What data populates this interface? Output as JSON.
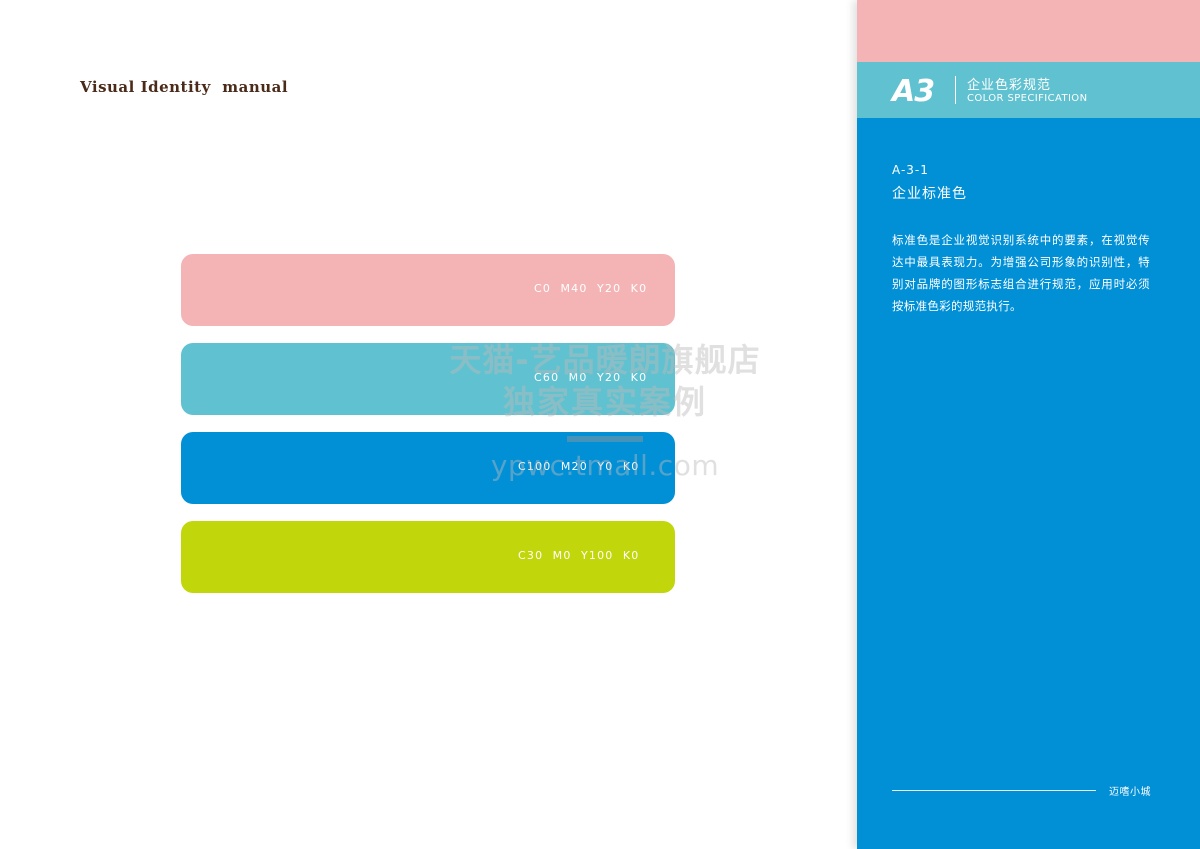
{
  "document": {
    "manual_title": "Visual Identity  manual"
  },
  "swatches": [
    {
      "label": "C0  M40  Y20  K0",
      "color": "#f4b4b5"
    },
    {
      "label": "C60  M0  Y20  K0",
      "color": "#60c1d0"
    },
    {
      "label": "C100  M20  Y0  K0",
      "color": "#018fd6"
    },
    {
      "label": "C30  M0  Y100  K0",
      "color": "#c2d60c"
    }
  ],
  "panel": {
    "top_band_color": "#f4b4b5",
    "header_color": "#60c1d0",
    "background_color": "#018fd6",
    "section_code": "A3",
    "section_title_cn": "企业色彩规范",
    "section_title_en": "COLOR SPECIFICATION",
    "subsection_code": "A-3-1",
    "subsection_title": "企业标准色",
    "description": "标准色是企业视觉识别系统中的要素，在视觉传达中最具表现力。为增强公司形象的识别性，特别对品牌的图形标志组合进行规范，应用时必须按标准色彩的规范执行。",
    "footer_brand": "迈嗜小城"
  },
  "watermark": {
    "line1": "天猫-艺品暖朗旗舰店",
    "line2": "独家真实案例",
    "url": "ypwc.tmall.com"
  }
}
